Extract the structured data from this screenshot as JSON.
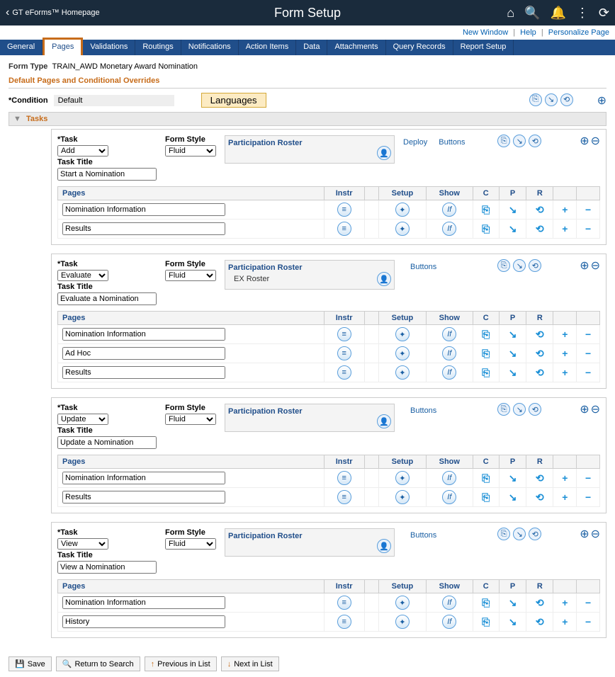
{
  "header": {
    "back_label": "GT eForms™ Homepage",
    "title": "Form Setup"
  },
  "util": {
    "new_window": "New Window",
    "help": "Help",
    "personalize": "Personalize Page"
  },
  "tabs": [
    "General",
    "Pages",
    "Validations",
    "Routings",
    "Notifications",
    "Action Items",
    "Data",
    "Attachments",
    "Query Records",
    "Report Setup"
  ],
  "active_tab": "Pages",
  "form_type_label": "Form Type",
  "form_type_value": "TRAIN_AWD Monetary Award Nomination",
  "section_title": "Default Pages and Conditional Overrides",
  "condition_label": "*Condition",
  "condition_value": "Default",
  "languages_btn": "Languages",
  "tasks_label": "Tasks",
  "task_field_label": "*Task",
  "form_style_label": "Form Style",
  "task_title_label": "Task Title",
  "participation_roster": "Participation Roster",
  "deploy_label": "Deploy",
  "buttons_label": "Buttons",
  "cols": {
    "pages": "Pages",
    "instr": "Instr",
    "setup": "Setup",
    "show": "Show",
    "c": "C",
    "p": "P",
    "r": "R"
  },
  "tasks": [
    {
      "task": "Add",
      "style": "Fluid",
      "title": "Start a Nomination",
      "show_deploy": true,
      "roster": [],
      "pages": [
        "Nomination Information",
        "Results"
      ]
    },
    {
      "task": "Evaluate",
      "style": "Fluid",
      "title": "Evaluate a Nomination",
      "show_deploy": false,
      "roster": [
        "EX Roster"
      ],
      "pages": [
        "Nomination Information",
        "Ad Hoc",
        "Results"
      ]
    },
    {
      "task": "Update",
      "style": "Fluid",
      "title": "Update a Nomination",
      "show_deploy": false,
      "roster": [],
      "pages": [
        "Nomination Information",
        "Results"
      ]
    },
    {
      "task": "View",
      "style": "Fluid",
      "title": "View a Nomination",
      "show_deploy": false,
      "roster": [],
      "pages": [
        "Nomination Information",
        "History"
      ]
    }
  ],
  "footer": {
    "save": "Save",
    "return": "Return to Search",
    "prev": "Previous in List",
    "next": "Next in List"
  }
}
